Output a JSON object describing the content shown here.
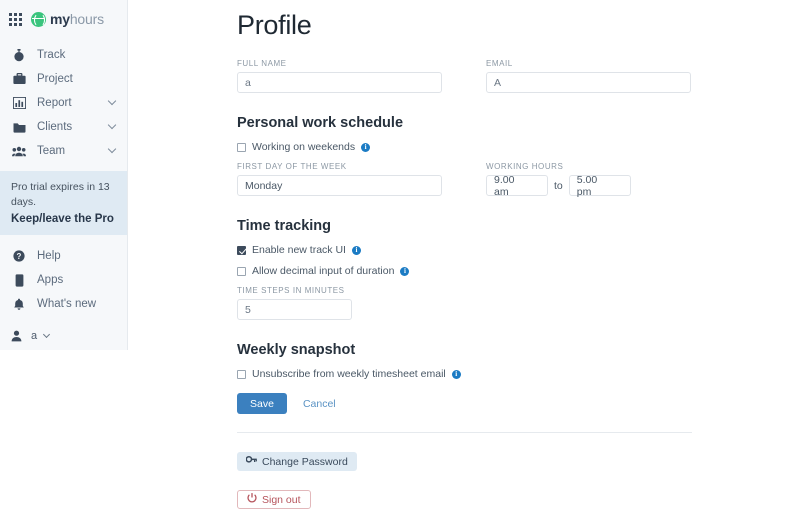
{
  "brand": {
    "my": "my",
    "hours": "hours"
  },
  "sidebar": {
    "nav": [
      {
        "label": "Track",
        "icon": "stopwatch-icon",
        "chevron": false
      },
      {
        "label": "Project",
        "icon": "briefcase-icon",
        "chevron": false
      },
      {
        "label": "Report",
        "icon": "bar-chart-icon",
        "chevron": true
      },
      {
        "label": "Clients",
        "icon": "folder-icon",
        "chevron": true
      },
      {
        "label": "Team",
        "icon": "people-icon",
        "chevron": true
      }
    ],
    "trial": {
      "text": "Pro trial expires in 13 days.",
      "link": "Keep/leave the Pro"
    },
    "nav2": [
      {
        "label": "Help",
        "icon": "help-circle-icon"
      },
      {
        "label": "Apps",
        "icon": "apps-icon"
      },
      {
        "label": "What's new",
        "icon": "bell-icon"
      }
    ],
    "account": {
      "label": "a",
      "icon": "user-icon"
    }
  },
  "main": {
    "page_title": "Profile",
    "fields": {
      "full_name_label": "FULL NAME",
      "full_name_value": "a",
      "email_label": "EMAIL",
      "email_value": "A"
    },
    "work_schedule": {
      "title": "Personal work schedule",
      "weekends_label": "Working on weekends",
      "weekends_checked": false,
      "first_day_label": "FIRST DAY OF THE WEEK",
      "first_day_value": "Monday",
      "working_hours_label": "WORKING HOURS",
      "start_time": "9.00 am",
      "to_label": "to",
      "end_time": "5.00 pm"
    },
    "time_tracking": {
      "title": "Time tracking",
      "new_ui_label": "Enable new track UI",
      "new_ui_checked": true,
      "decimal_label": "Allow decimal input of duration",
      "decimal_checked": false,
      "steps_label": "TIME STEPS IN MINUTES",
      "steps_value": "5"
    },
    "weekly_snapshot": {
      "title": "Weekly snapshot",
      "unsubscribe_label": "Unsubscribe from weekly timesheet email",
      "unsubscribe_checked": false
    },
    "actions": {
      "save": "Save",
      "cancel": "Cancel",
      "change_password": "Change Password",
      "sign_out": "Sign out"
    }
  },
  "colors": {
    "accent_blue": "#3b80bf",
    "brand_green": "#3ac47d",
    "info_blue": "#1b7bc4",
    "danger_red": "#b5535b",
    "sidebar_bg": "#f6f8fa",
    "trial_bg": "#dfeaf3"
  }
}
